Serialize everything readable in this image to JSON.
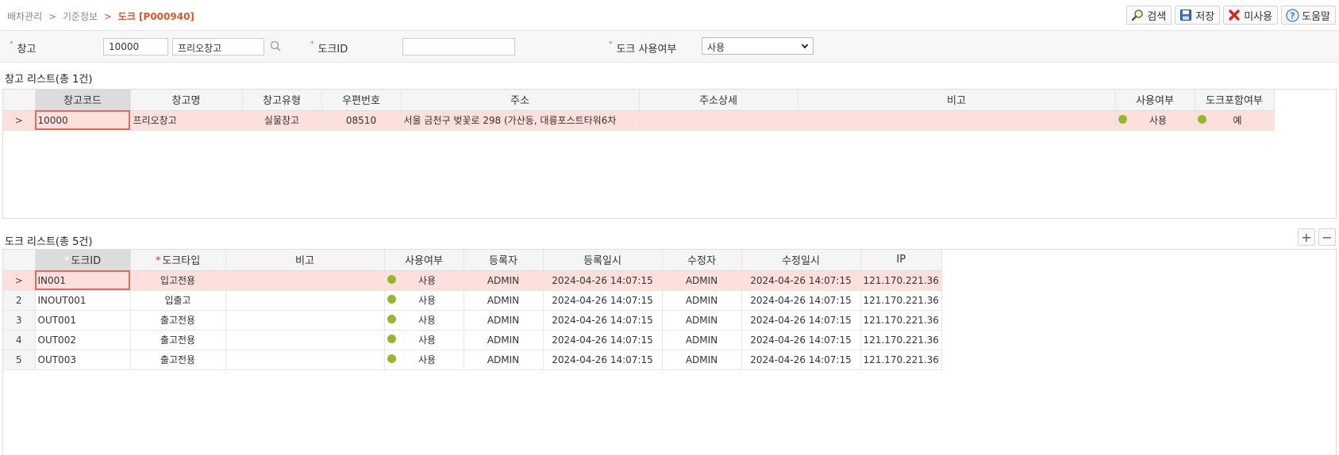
{
  "breadcrumb": {
    "level1": "배차관리",
    "sep": ">",
    "level2": "기준정보",
    "current": "도크 [P000940]"
  },
  "toolbar": {
    "search": "검색",
    "save": "저장",
    "disable": "미사용",
    "help": "도움말"
  },
  "search": {
    "warehouse_label": "창고",
    "warehouse_code": "10000",
    "warehouse_name": "프리오창고",
    "dock_id_label": "도크ID",
    "dock_id_value": "",
    "dock_use_label": "도크 사용여부",
    "dock_use_value": "사용"
  },
  "warehouse_list": {
    "title": "창고 리스트(총 1건)",
    "columns": [
      "창고코드",
      "창고명",
      "창고유형",
      "우편번호",
      "주소",
      "주소상세",
      "비고",
      "사용여부",
      "도크포함여부"
    ],
    "rows": [
      {
        "row": ">",
        "code": "10000",
        "name": "프리오창고",
        "type": "실물창고",
        "zip": "08510",
        "address": "서울 금천구 벚꽃로 298 (가산동, 대륭포스트타워6차",
        "address_detail": "",
        "note": "",
        "use": "사용",
        "dock_included": "예"
      }
    ]
  },
  "dock_list": {
    "title": "도크 리스트(총 5건)",
    "columns": [
      "도크ID",
      "도크타입",
      "비고",
      "사용여부",
      "등록자",
      "등록일시",
      "수정자",
      "수정일시",
      "IP"
    ],
    "rows": [
      {
        "row": ">",
        "id": "IN001",
        "type": "입고전용",
        "note": "",
        "use": "사용",
        "reg_user": "ADMIN",
        "reg_date": "2024-04-26 14:07:15",
        "mod_user": "ADMIN",
        "mod_date": "2024-04-26 14:07:15",
        "ip": "121.170.221.36"
      },
      {
        "row": "2",
        "id": "INOUT001",
        "type": "입출고",
        "note": "",
        "use": "사용",
        "reg_user": "ADMIN",
        "reg_date": "2024-04-26 14:07:15",
        "mod_user": "ADMIN",
        "mod_date": "2024-04-26 14:07:15",
        "ip": "121.170.221.36"
      },
      {
        "row": "3",
        "id": "OUT001",
        "type": "출고전용",
        "note": "",
        "use": "사용",
        "reg_user": "ADMIN",
        "reg_date": "2024-04-26 14:07:15",
        "mod_user": "ADMIN",
        "mod_date": "2024-04-26 14:07:15",
        "ip": "121.170.221.36"
      },
      {
        "row": "4",
        "id": "OUT002",
        "type": "출고전용",
        "note": "",
        "use": "사용",
        "reg_user": "ADMIN",
        "reg_date": "2024-04-26 14:07:15",
        "mod_user": "ADMIN",
        "mod_date": "2024-04-26 14:07:15",
        "ip": "121.170.221.36"
      },
      {
        "row": "5",
        "id": "OUT003",
        "type": "출고전용",
        "note": "",
        "use": "사용",
        "reg_user": "ADMIN",
        "reg_date": "2024-04-26 14:07:15",
        "mod_user": "ADMIN",
        "mod_date": "2024-04-26 14:07:15",
        "ip": "121.170.221.36"
      }
    ]
  },
  "grid_controls": {
    "add": "+",
    "remove": "−"
  },
  "colors": {
    "accent": "#e0562b",
    "selected_row": "#fde0dc",
    "status_dot": "#94b82a",
    "required": "#e0302b"
  },
  "icons": {
    "search": "magnifier-icon",
    "save": "floppy-icon",
    "disable": "red-x-icon",
    "help": "question-circle-icon"
  }
}
